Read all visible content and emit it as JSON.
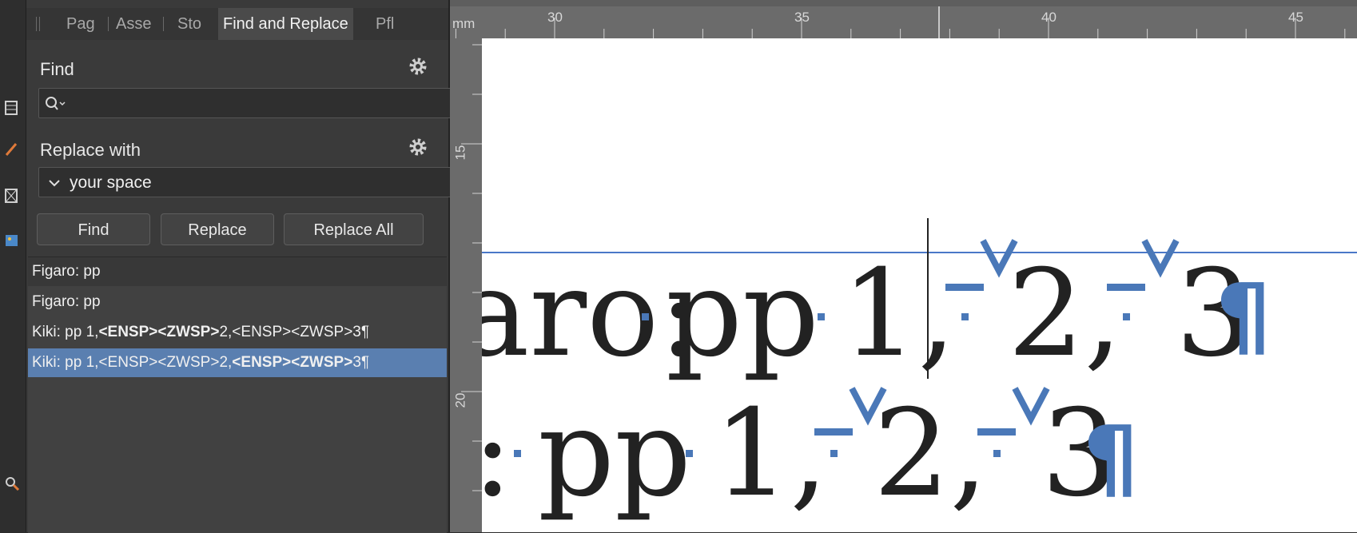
{
  "tabs": [
    {
      "label": "Pag",
      "active": false
    },
    {
      "label": "Asse",
      "active": false
    },
    {
      "label": "Sto",
      "active": false
    },
    {
      "label": "Find and Replace",
      "active": true
    },
    {
      "label": "Pfl",
      "active": false
    }
  ],
  "find": {
    "label": "Find",
    "value": "",
    "search_icon": "search-icon"
  },
  "replace": {
    "label": "Replace with",
    "value": "your space"
  },
  "buttons": {
    "find": "Find",
    "replace": "Replace",
    "replace_all": "Replace All"
  },
  "results": [
    {
      "prefix": "Figaro: pp",
      "bold1": "",
      "mid": "",
      "bold2": "",
      "suffix": ""
    },
    {
      "prefix": "Figaro: pp",
      "bold1": "",
      "mid": "",
      "bold2": "",
      "suffix": ""
    },
    {
      "prefix": "Kiki: pp 1,",
      "bold1": "<ENSP><ZWSP>",
      "mid": "2,<ENSP><ZWSP>3¶",
      "bold2": "",
      "suffix": ""
    },
    {
      "prefix": "Kiki: pp 1,<ENSP><ZWSP>2,",
      "bold1": "",
      "mid": "",
      "bold2": "<ENSP><ZWSP>",
      "suffix": "3¶"
    }
  ],
  "ruler": {
    "unit": "mm",
    "top_labels": [
      "30",
      "35",
      "40",
      "45"
    ],
    "left_labels": [
      "15",
      "20"
    ]
  },
  "document": {
    "line1": [
      "aro:",
      "pp",
      "1,",
      "2,",
      "3"
    ],
    "line2": [
      "i:",
      "pp",
      "1,",
      "2,",
      "3"
    ],
    "pilcrow": "¶"
  },
  "colors": {
    "accent": "#5a7fb0",
    "invisible_chars": "#4a78b8",
    "baseline_guide": "#4a78c8"
  }
}
